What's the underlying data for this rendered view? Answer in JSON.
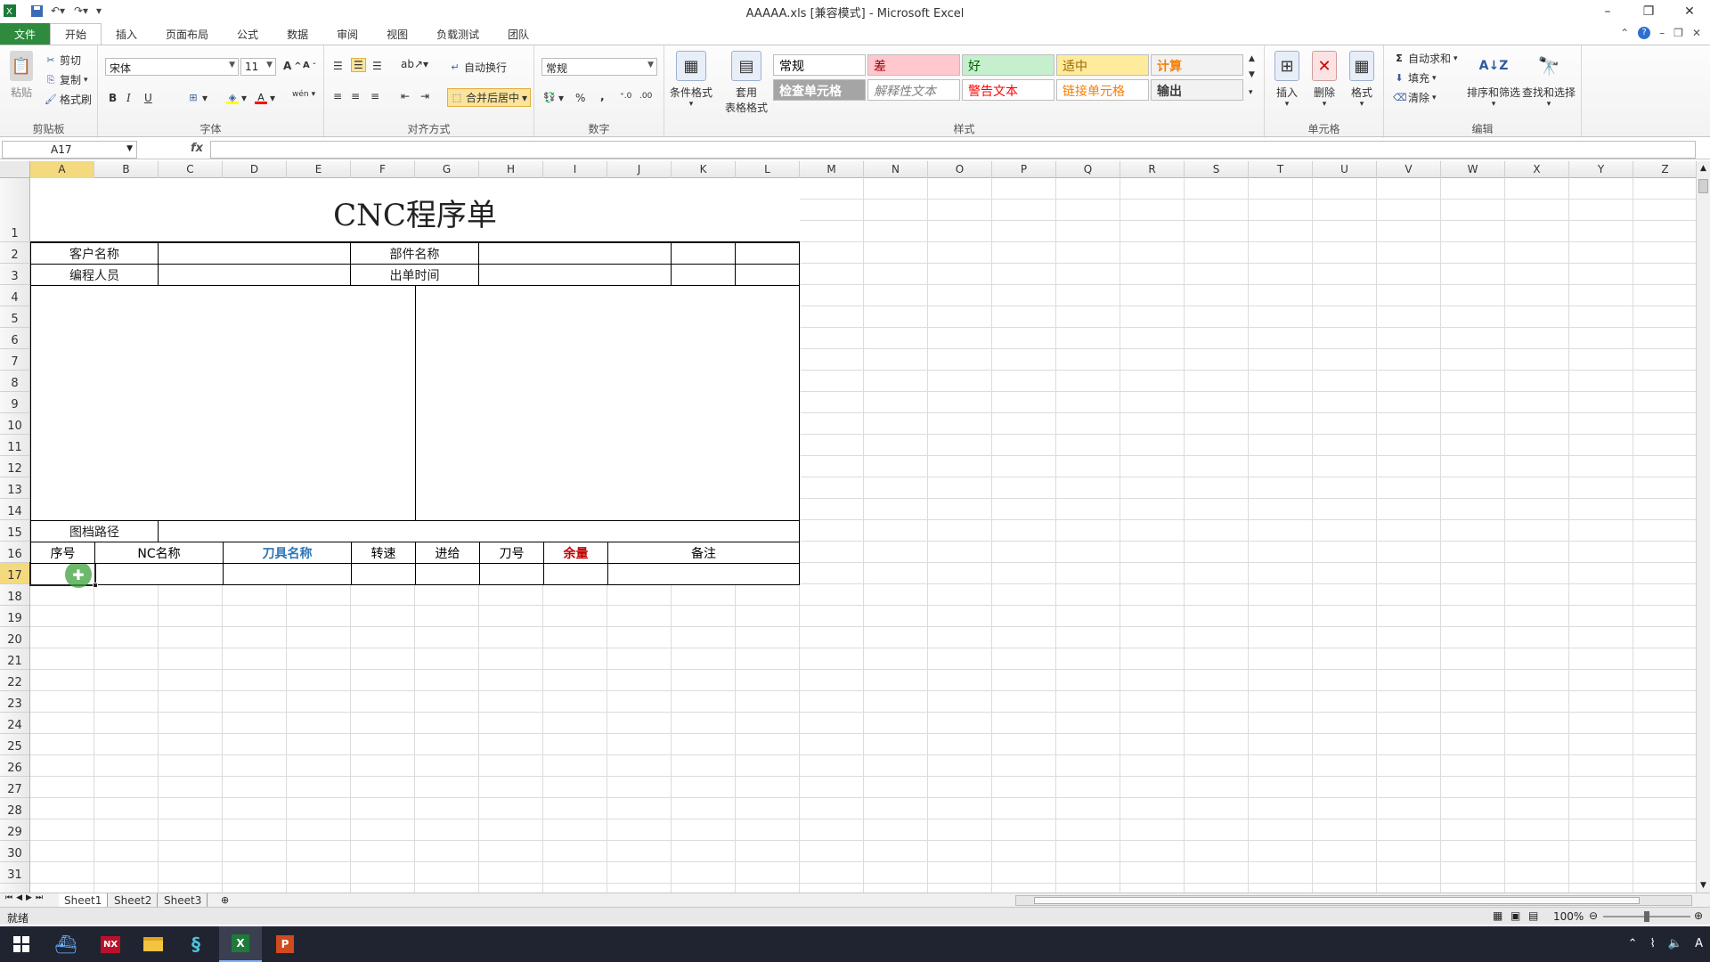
{
  "window": {
    "title": "AAAAA.xls  [兼容模式] - Microsoft Excel",
    "minimize_icon": "minimize-icon",
    "restore_icon": "restore-icon",
    "close_icon": "close-icon"
  },
  "quick_access": [
    "excel-logo-icon",
    "save-icon",
    "undo-icon",
    "redo-icon",
    "customize-qat-icon"
  ],
  "tabs": [
    {
      "label": "文件"
    },
    {
      "label": "开始"
    },
    {
      "label": "插入"
    },
    {
      "label": "页面布局"
    },
    {
      "label": "公式"
    },
    {
      "label": "数据"
    },
    {
      "label": "审阅"
    },
    {
      "label": "视图"
    },
    {
      "label": "负载测试"
    },
    {
      "label": "团队"
    }
  ],
  "ribbon": {
    "clipboard": {
      "label": "剪贴板",
      "paste": "粘贴",
      "cut": "剪切",
      "copy": "复制",
      "format_painter": "格式刷"
    },
    "font": {
      "label": "字体",
      "font_name": "宋体",
      "font_size": "11",
      "bold": "B",
      "italic": "I",
      "underline": "U",
      "wen": "wén"
    },
    "alignment": {
      "label": "对齐方式",
      "wrap": "自动换行",
      "merge": "合并后居中"
    },
    "number": {
      "label": "数字",
      "format": "常规",
      "percent": "%",
      "comma": ","
    },
    "styles": {
      "label": "样式",
      "conditional": "条件格式",
      "table_format_line1": "套用",
      "table_format_line2": "表格格式",
      "cells": [
        {
          "text": "常规",
          "bg": "#ffffff",
          "color": "#000000",
          "italic": false,
          "bold": false
        },
        {
          "text": "差",
          "bg": "#ffc7ce",
          "color": "#9c0006",
          "italic": false,
          "bold": false
        },
        {
          "text": "好",
          "bg": "#c6efce",
          "color": "#006100",
          "italic": false,
          "bold": false
        },
        {
          "text": "适中",
          "bg": "#ffeb9c",
          "color": "#9c6500",
          "italic": false,
          "bold": false
        },
        {
          "text": "计算",
          "bg": "#f2f2f2",
          "color": "#fa7d00",
          "italic": false,
          "bold": true
        },
        {
          "text": "检查单元格",
          "bg": "#a5a5a5",
          "color": "#ffffff",
          "italic": false,
          "bold": true
        },
        {
          "text": "解释性文本",
          "bg": "#ffffff",
          "color": "#7f7f7f",
          "italic": true,
          "bold": false
        },
        {
          "text": "警告文本",
          "bg": "#ffffff",
          "color": "#ff0000",
          "italic": false,
          "bold": false
        },
        {
          "text": "链接单元格",
          "bg": "#ffffff",
          "color": "#fa7d00",
          "italic": false,
          "bold": false
        },
        {
          "text": "输出",
          "bg": "#f2f2f2",
          "color": "#3f3f3f",
          "italic": false,
          "bold": true
        }
      ]
    },
    "cells": {
      "label": "单元格",
      "insert": "插入",
      "delete": "删除",
      "format": "格式"
    },
    "editing": {
      "label": "编辑",
      "autosum": "自动求和",
      "fill": "填充",
      "clear": "清除",
      "sort": "排序和筛选",
      "find": "查找和选择"
    }
  },
  "formula_bar": {
    "name_box": "A17",
    "fx": "fx",
    "value": ""
  },
  "columns": [
    "A",
    "B",
    "C",
    "D",
    "E",
    "F",
    "G",
    "H",
    "I",
    "J",
    "K",
    "L",
    "M",
    "N",
    "O",
    "P",
    "Q",
    "R",
    "S",
    "T",
    "U",
    "V",
    "W",
    "X",
    "Y",
    "Z"
  ],
  "selected_column": "A",
  "rows": [
    "1",
    "2",
    "3",
    "4",
    "5",
    "6",
    "7",
    "8",
    "9",
    "10",
    "11",
    "12",
    "13",
    "14",
    "15",
    "16",
    "17",
    "18",
    "19",
    "20",
    "21",
    "22",
    "23",
    "24",
    "25",
    "26",
    "27",
    "28",
    "29",
    "30",
    "31"
  ],
  "selected_row": "17",
  "sheet_form": {
    "title": "CNC程序单",
    "customer_label": "客户名称",
    "part_label": "部件名称",
    "programmer_label": "编程人员",
    "date_label": "出单时间",
    "path_label": "图档路径",
    "table_headers": [
      {
        "text": "序号",
        "color": "#000000",
        "bold": false
      },
      {
        "text": "NC名称",
        "color": "#000000",
        "bold": false
      },
      {
        "text": "刀具名称",
        "color": "#2e75b6",
        "bold": true
      },
      {
        "text": "转速",
        "color": "#000000",
        "bold": false
      },
      {
        "text": "进给",
        "color": "#000000",
        "bold": false
      },
      {
        "text": "刀号",
        "color": "#000000",
        "bold": false
      },
      {
        "text": "余量",
        "color": "#c00000",
        "bold": true
      },
      {
        "text": "备注",
        "color": "#000000",
        "bold": false
      }
    ]
  },
  "sheets": [
    {
      "name": "Sheet1",
      "active": true
    },
    {
      "name": "Sheet2",
      "active": false
    },
    {
      "name": "Sheet3",
      "active": false
    }
  ],
  "status": {
    "ready": "就绪",
    "zoom": "100%"
  },
  "taskbar": {
    "apps": [
      "start-icon",
      "app-icon",
      "nx-icon",
      "file-explorer-icon",
      "ps-icon",
      "excel-icon",
      "powerpoint-icon"
    ],
    "nx_label": "NX"
  }
}
